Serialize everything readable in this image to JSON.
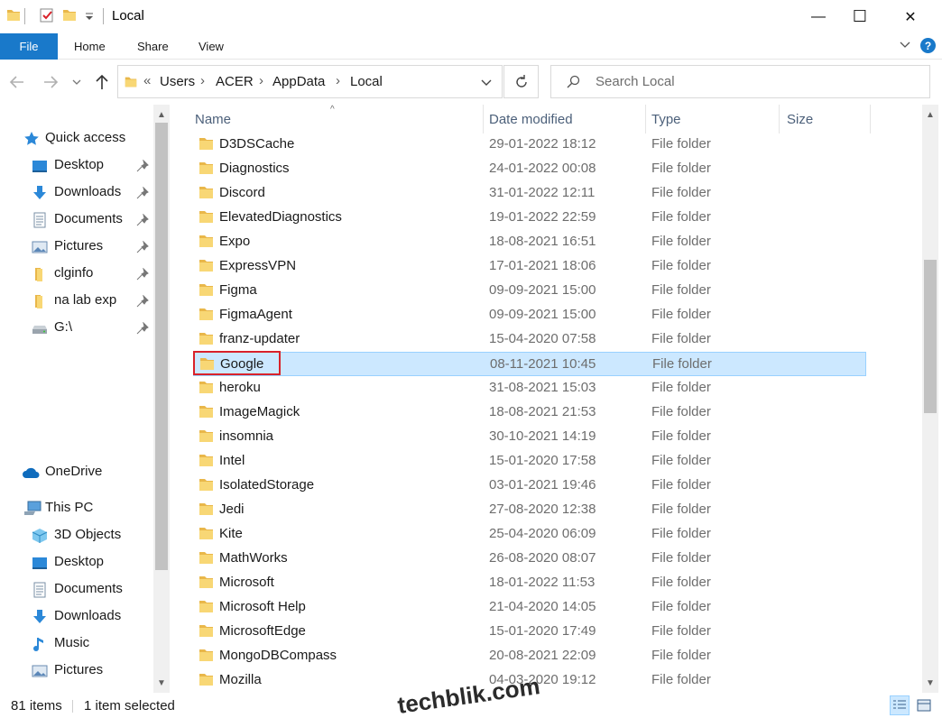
{
  "window": {
    "title": "Local",
    "controls": {
      "minimize": "—",
      "maximize": "☐",
      "close": "✕"
    }
  },
  "ribbon": {
    "tabs": [
      {
        "label": "File"
      },
      {
        "label": "Home"
      },
      {
        "label": "Share"
      },
      {
        "label": "View"
      }
    ],
    "help": "?"
  },
  "address_bar": {
    "overflow": "«",
    "crumbs": [
      "Users",
      "ACER",
      "AppData",
      "Local"
    ],
    "separator": "›"
  },
  "search": {
    "placeholder": "Search Local"
  },
  "nav_pane": {
    "quick_access": {
      "label": "Quick access",
      "icon": "star-icon"
    },
    "pinned": [
      {
        "label": "Desktop",
        "icon": "desktop-icon"
      },
      {
        "label": "Downloads",
        "icon": "download-arrow-icon"
      },
      {
        "label": "Documents",
        "icon": "documents-icon"
      },
      {
        "label": "Pictures",
        "icon": "pictures-icon"
      },
      {
        "label": "clginfo",
        "icon": "folder-icon"
      },
      {
        "label": "na lab exp",
        "icon": "folder-icon"
      },
      {
        "label": "G:\\",
        "icon": "drive-icon"
      }
    ],
    "onedrive": {
      "label": "OneDrive",
      "icon": "cloud-icon"
    },
    "this_pc": {
      "label": "This PC",
      "icon": "computer-icon"
    },
    "this_pc_items": [
      {
        "label": "3D Objects",
        "icon": "cube-icon"
      },
      {
        "label": "Desktop",
        "icon": "desktop-icon"
      },
      {
        "label": "Documents",
        "icon": "documents-icon"
      },
      {
        "label": "Downloads",
        "icon": "download-arrow-icon"
      },
      {
        "label": "Music",
        "icon": "music-note-icon"
      },
      {
        "label": "Pictures",
        "icon": "pictures-icon"
      }
    ]
  },
  "columns": {
    "name": "Name",
    "date_modified": "Date modified",
    "type": "Type",
    "size": "Size"
  },
  "files": [
    {
      "name": "D3DSCache",
      "date": "29-01-2022 18:12",
      "type": "File folder"
    },
    {
      "name": "Diagnostics",
      "date": "24-01-2022 00:08",
      "type": "File folder"
    },
    {
      "name": "Discord",
      "date": "31-01-2022 12:11",
      "type": "File folder"
    },
    {
      "name": "ElevatedDiagnostics",
      "date": "19-01-2022 22:59",
      "type": "File folder"
    },
    {
      "name": "Expo",
      "date": "18-08-2021 16:51",
      "type": "File folder"
    },
    {
      "name": "ExpressVPN",
      "date": "17-01-2021 18:06",
      "type": "File folder"
    },
    {
      "name": "Figma",
      "date": "09-09-2021 15:00",
      "type": "File folder"
    },
    {
      "name": "FigmaAgent",
      "date": "09-09-2021 15:00",
      "type": "File folder"
    },
    {
      "name": "franz-updater",
      "date": "15-04-2020 07:58",
      "type": "File folder"
    },
    {
      "name": "Google",
      "date": "08-11-2021 10:45",
      "type": "File folder",
      "selected": true
    },
    {
      "name": "heroku",
      "date": "31-08-2021 15:03",
      "type": "File folder"
    },
    {
      "name": "ImageMagick",
      "date": "18-08-2021 21:53",
      "type": "File folder"
    },
    {
      "name": "insomnia",
      "date": "30-10-2021 14:19",
      "type": "File folder"
    },
    {
      "name": "Intel",
      "date": "15-01-2020 17:58",
      "type": "File folder"
    },
    {
      "name": "IsolatedStorage",
      "date": "03-01-2021 19:46",
      "type": "File folder"
    },
    {
      "name": "Jedi",
      "date": "27-08-2020 12:38",
      "type": "File folder"
    },
    {
      "name": "Kite",
      "date": "25-04-2020 06:09",
      "type": "File folder"
    },
    {
      "name": "MathWorks",
      "date": "26-08-2020 08:07",
      "type": "File folder"
    },
    {
      "name": "Microsoft",
      "date": "18-01-2022 11:53",
      "type": "File folder"
    },
    {
      "name": "Microsoft Help",
      "date": "21-04-2020 14:05",
      "type": "File folder"
    },
    {
      "name": "MicrosoftEdge",
      "date": "15-01-2020 17:49",
      "type": "File folder"
    },
    {
      "name": "MongoDBCompass",
      "date": "20-08-2021 22:09",
      "type": "File folder"
    },
    {
      "name": "Mozilla",
      "date": "04-03-2020 19:12",
      "type": "File folder"
    }
  ],
  "status": {
    "item_count": "81 items",
    "selection": "1 item selected"
  },
  "watermark": "techblik.com",
  "colors": {
    "accent": "#1979ca",
    "selection_bg": "#cce8ff",
    "selection_border": "#99d1ff",
    "highlight_box": "#d9222a",
    "folder_yellow": "#f8d775"
  }
}
